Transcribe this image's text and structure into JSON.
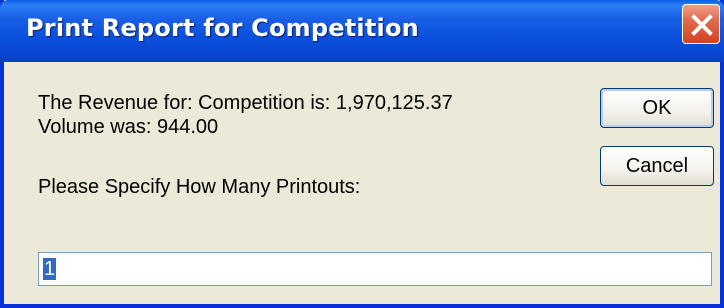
{
  "window": {
    "title": "Print Report for Competition",
    "close_icon": "close-icon"
  },
  "message": {
    "revenue_line": "The Revenue for: Competition is: 1,970,125.37",
    "volume_line": "Volume was: 944.00",
    "prompt": "Please Specify How Many Printouts:"
  },
  "buttons": {
    "ok_label": "OK",
    "cancel_label": "Cancel"
  },
  "printouts_input": {
    "value": "1"
  },
  "colors": {
    "titlebar": "#0a50dc",
    "dialog_bg": "#ece9d8",
    "close_button": "#d2421f",
    "selection": "#316ac5"
  }
}
